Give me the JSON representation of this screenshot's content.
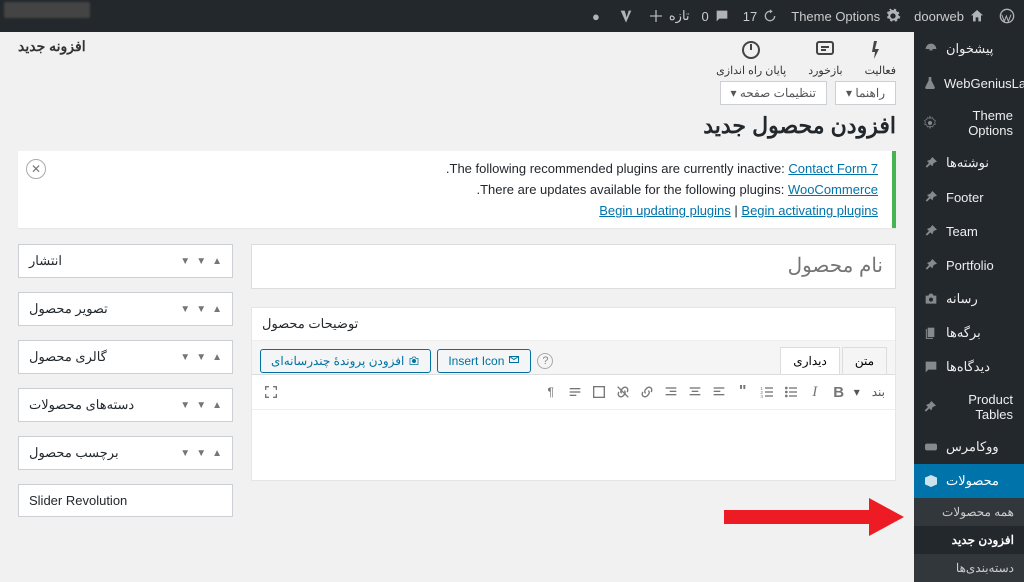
{
  "adminbar": {
    "left_items": [
      {
        "icon": "wp",
        "label": "doorweb"
      },
      {
        "icon": "gear",
        "label": "Theme Options"
      },
      {
        "icon": "refresh",
        "label": "17"
      },
      {
        "icon": "comment",
        "label": "0"
      },
      {
        "icon": "plus",
        "label": "تازه"
      },
      {
        "icon": "yoast",
        "label": ""
      },
      {
        "icon": "dot",
        "label": ""
      }
    ]
  },
  "sidebar": {
    "items": [
      {
        "name": "dashboard",
        "label": "پیشخوان",
        "icon": "gauge"
      },
      {
        "name": "webgeniuslab",
        "label": "WebGeniusLab",
        "icon": "flask"
      },
      {
        "name": "theme-options",
        "label": "Theme Options",
        "icon": "gear"
      },
      {
        "name": "posts",
        "label": "نوشته‌ها",
        "icon": "pin"
      },
      {
        "name": "footer",
        "label": "Footer",
        "icon": "pin"
      },
      {
        "name": "team",
        "label": "Team",
        "icon": "pin"
      },
      {
        "name": "portfolio",
        "label": "Portfolio",
        "icon": "pin"
      },
      {
        "name": "media",
        "label": "رسانه",
        "icon": "camera"
      },
      {
        "name": "pages",
        "label": "برگه‌ها",
        "icon": "copy"
      },
      {
        "name": "comments",
        "label": "دیدگاه‌ها",
        "icon": "comment"
      },
      {
        "name": "product-tables",
        "label": "Product Tables",
        "icon": "pin"
      },
      {
        "name": "woocommerce",
        "label": "ووکامرس",
        "icon": "woo"
      },
      {
        "name": "products",
        "label": "محصولات",
        "icon": "box",
        "active": true
      }
    ],
    "submenu": [
      {
        "label": "همه محصولات",
        "current": false
      },
      {
        "label": "افزودن جدید",
        "current": true
      },
      {
        "label": "دسته‌بندی‌ها",
        "current": false
      }
    ]
  },
  "topbar": {
    "new_plugin": "افزونه جدید",
    "tabs": [
      {
        "label": "فعالیت",
        "icon": "spark"
      },
      {
        "label": "بازخورد",
        "icon": "chat"
      },
      {
        "label": "پایان راه اندازی",
        "icon": "power"
      }
    ],
    "ctx_settings": "تنظیمات صفحه ▾",
    "ctx_help": "راهنما ▾"
  },
  "heading": "افزودن محصول جدید",
  "notice": {
    "line1_prefix": ".The following recommended plugins are currently inactive: ",
    "line1_link": "Contact Form 7",
    "line2_prefix": ".There are updates available for the following plugins: ",
    "line2_link": "WooCommerce",
    "line3_a": "Begin updating plugins",
    "line3_sep": " | ",
    "line3_b": "Begin activating plugins"
  },
  "title_placeholder": "نام محصول",
  "editor": {
    "box_title": "توضیحات محصول",
    "tab_visual": "دیداری",
    "tab_text": "متن",
    "add_media": "افزودن پروندهٔ چندرسانه‌ای",
    "insert_icon": "Insert Icon",
    "paragraph": "بند"
  },
  "metaboxes": [
    {
      "label": "انتشار"
    },
    {
      "label": "تصویر محصول"
    },
    {
      "label": "گالری محصول"
    },
    {
      "label": "دسته‌های محصولات"
    },
    {
      "label": "برچسب محصول"
    },
    {
      "label": "Slider Revolution"
    }
  ]
}
